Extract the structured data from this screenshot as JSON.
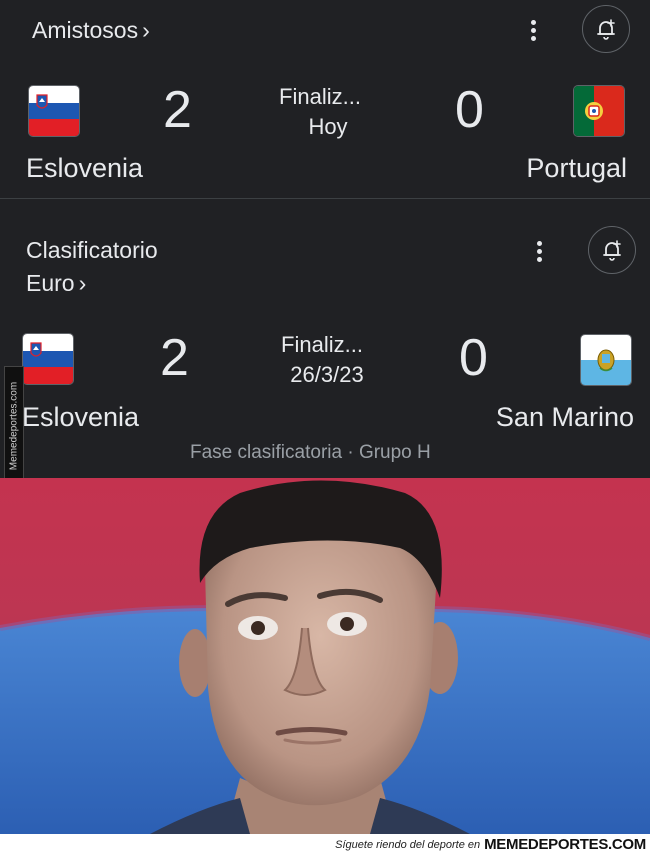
{
  "match1": {
    "competition": "Amistosos",
    "chevron": "›",
    "status_line1": "Finaliz...",
    "status_line2": "Hoy",
    "home": {
      "name": "Eslovenia",
      "score": "2",
      "flag": "slovenia-flag"
    },
    "away": {
      "name": "Portugal",
      "score": "0",
      "flag": "portugal-flag"
    },
    "icons": [
      "more-vert-icon",
      "bell-add-icon"
    ]
  },
  "match2": {
    "competition_line1": "Clasificatorio",
    "competition_line2": "Euro",
    "chevron": "›",
    "status_line1": "Finaliz...",
    "status_line2": "26/3/23",
    "home": {
      "name": "Eslovenia",
      "score": "2",
      "flag": "slovenia-flag"
    },
    "away": {
      "name": "San Marino",
      "score": "0",
      "flag": "san-marino-flag"
    },
    "stage": "Fase clasificatoria · Grupo H",
    "icons": [
      "more-vert-icon",
      "bell-add-icon"
    ]
  },
  "watermark": {
    "side_text": "Memedeportes.com"
  },
  "footer": {
    "text": "Síguete riendo del deporte en",
    "brand": "MEMEDEPORTES.COM"
  },
  "colors": {
    "background": "#202124",
    "text": "#e8eaed",
    "muted": "#9aa0a6",
    "slovenia_red": "#e21f26",
    "slovenia_blue": "#1d57b2",
    "portugal_green": "#046a38",
    "portugal_red": "#da291c",
    "san_marino_blue": "#5eb6e4"
  }
}
